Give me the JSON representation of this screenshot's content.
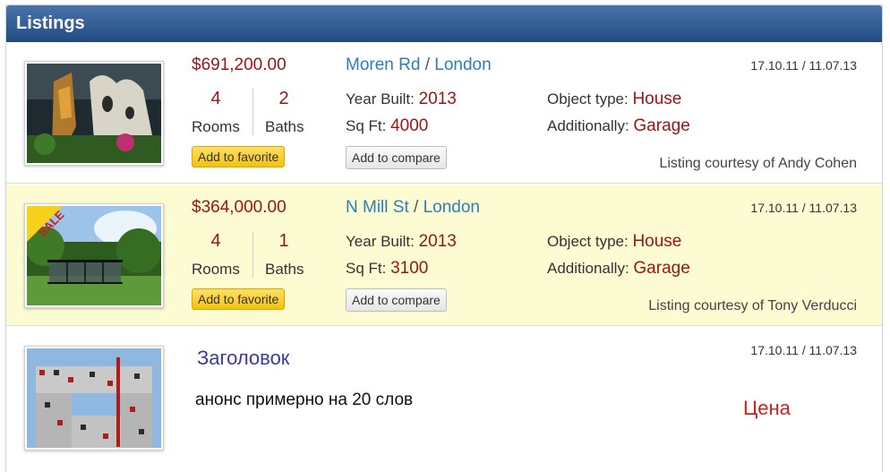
{
  "panel": {
    "title": "Listings"
  },
  "listings": [
    {
      "price": "$691,200.00",
      "rooms": "4",
      "rooms_label": "Rooms",
      "baths": "2",
      "baths_label": "Baths",
      "street": "Moren Rd",
      "separator": " / ",
      "city": "London",
      "year_label": "Year Built: ",
      "year": "2013",
      "sqft_label": "Sq Ft: ",
      "sqft": "4000",
      "type_label": "Object type: ",
      "type": "House",
      "add_label": "Additionally: ",
      "add": "Garage",
      "dates": "17.10.11 / 11.07.13",
      "courtesy": "Listing courtesy of Andy Cohen",
      "fav_label": "Add to favorite",
      "compare_label": "Add to compare"
    },
    {
      "price": "$364,000.00",
      "rooms": "4",
      "rooms_label": "Rooms",
      "baths": "1",
      "baths_label": "Baths",
      "street": "N Mill St",
      "separator": " / ",
      "city": "London",
      "year_label": "Year Built: ",
      "year": "2013",
      "sqft_label": "Sq Ft: ",
      "sqft": "3100",
      "type_label": "Object type: ",
      "type": "House",
      "add_label": "Additionally: ",
      "add": "Garage",
      "dates": "17.10.11 / 11.07.13",
      "courtesy": "Listing courtesy of Tony Verducci",
      "fav_label": "Add to favorite",
      "compare_label": "Add to compare",
      "badge": "SALE"
    },
    {
      "title": "Заголовок",
      "announce": "анонс примерно на 20 слов",
      "price": "Цена",
      "dates": "17.10.11 / 11.07.13"
    }
  ],
  "colors": {
    "header": "#2b5a94",
    "price": "#9a1414",
    "link": "#2a7fb8",
    "sale_bg": "#fdfbd2",
    "fav_button": "#f4c20d"
  }
}
